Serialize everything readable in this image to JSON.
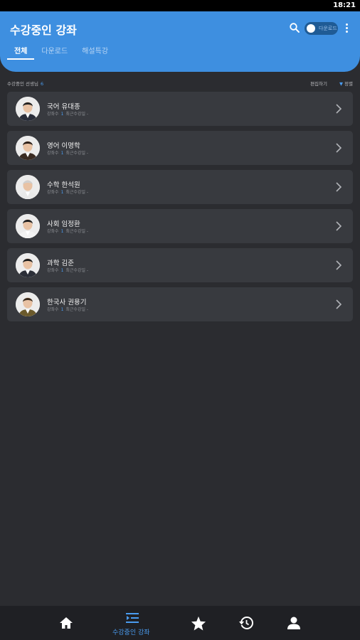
{
  "status_bar": {
    "time": "18:21"
  },
  "header": {
    "title": "수강중인 강좌",
    "toggle_label": "다운로드"
  },
  "tabs": [
    {
      "label": "전체",
      "active": true
    },
    {
      "label": "다운로드",
      "active": false
    },
    {
      "label": "해설특강",
      "active": false
    }
  ],
  "subbar": {
    "count_label": "수강중인 선생님",
    "count": "6",
    "edit_label": "편집하기",
    "sort_label": "정렬"
  },
  "lectures": [
    {
      "subject": "국어",
      "teacher": "유대종",
      "meta_label": "강좌수",
      "meta_count": "1",
      "meta_recent": "최근수강일 -",
      "hair": "#222",
      "suit": "#2a2e3a"
    },
    {
      "subject": "영어",
      "teacher": "이명학",
      "meta_label": "강좌수",
      "meta_count": "1",
      "meta_recent": "최근수강일 -",
      "hair": "#2a1e18",
      "suit": "#3a2b22"
    },
    {
      "subject": "수학",
      "teacher": "한석원",
      "meta_label": "강좌수",
      "meta_count": "1",
      "meta_recent": "최근수강일 -",
      "hair": "#cfcfcf",
      "suit": "#e9e9e9"
    },
    {
      "subject": "사회",
      "teacher": "임정환",
      "meta_label": "강좌수",
      "meta_count": "1",
      "meta_recent": "최근수강일 -",
      "hair": "#1e1e1e",
      "suit": "#f2f2f2"
    },
    {
      "subject": "과학",
      "teacher": "김준",
      "meta_label": "강좌수",
      "meta_count": "1",
      "meta_recent": "최근수강일 -",
      "hair": "#1b1b1b",
      "suit": "#2c2f38"
    },
    {
      "subject": "한국사",
      "teacher": "권용기",
      "meta_label": "강좌수",
      "meta_count": "1",
      "meta_recent": "최근수강일 -",
      "hair": "#3a2a1c",
      "suit": "#6b5a2c"
    }
  ],
  "bottom_nav": [
    {
      "icon": "home-icon",
      "label": "",
      "active": false
    },
    {
      "icon": "course-list-icon",
      "label": "수강중인 강좌",
      "active": true
    },
    {
      "icon": "star-icon",
      "label": "",
      "active": false
    },
    {
      "icon": "history-icon",
      "label": "",
      "active": false
    },
    {
      "icon": "person-icon",
      "label": "",
      "active": false
    }
  ],
  "colors": {
    "accent": "#3e8fe0",
    "highlight": "#4a9cf0",
    "background": "#2b2c30",
    "card": "#383a3f",
    "nav_background": "#1f2024"
  }
}
